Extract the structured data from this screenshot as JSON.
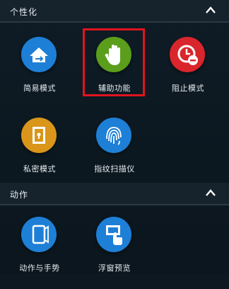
{
  "sections": [
    {
      "title": "个性化",
      "items": [
        {
          "label": "简易模式",
          "icon": "easy-mode-icon",
          "color": "#1e7fd6"
        },
        {
          "label": "辅助功能",
          "icon": "hand-icon",
          "color": "#5a9e1c"
        },
        {
          "label": "阻止模式",
          "icon": "block-mode-icon",
          "color": "#d9262c"
        },
        {
          "label": "私密模式",
          "icon": "private-mode-icon",
          "color": "#d9961a"
        },
        {
          "label": "指纹扫描仪",
          "icon": "fingerprint-icon",
          "color": "#1e7fd6"
        }
      ]
    },
    {
      "title": "动作",
      "items": [
        {
          "label": "动作与手势",
          "icon": "motion-gesture-icon",
          "color": "#1e7fd6"
        },
        {
          "label": "浮窗预览",
          "icon": "air-view-icon",
          "color": "#1e7fd6"
        }
      ]
    }
  ],
  "highlight_color": "#e0141e"
}
